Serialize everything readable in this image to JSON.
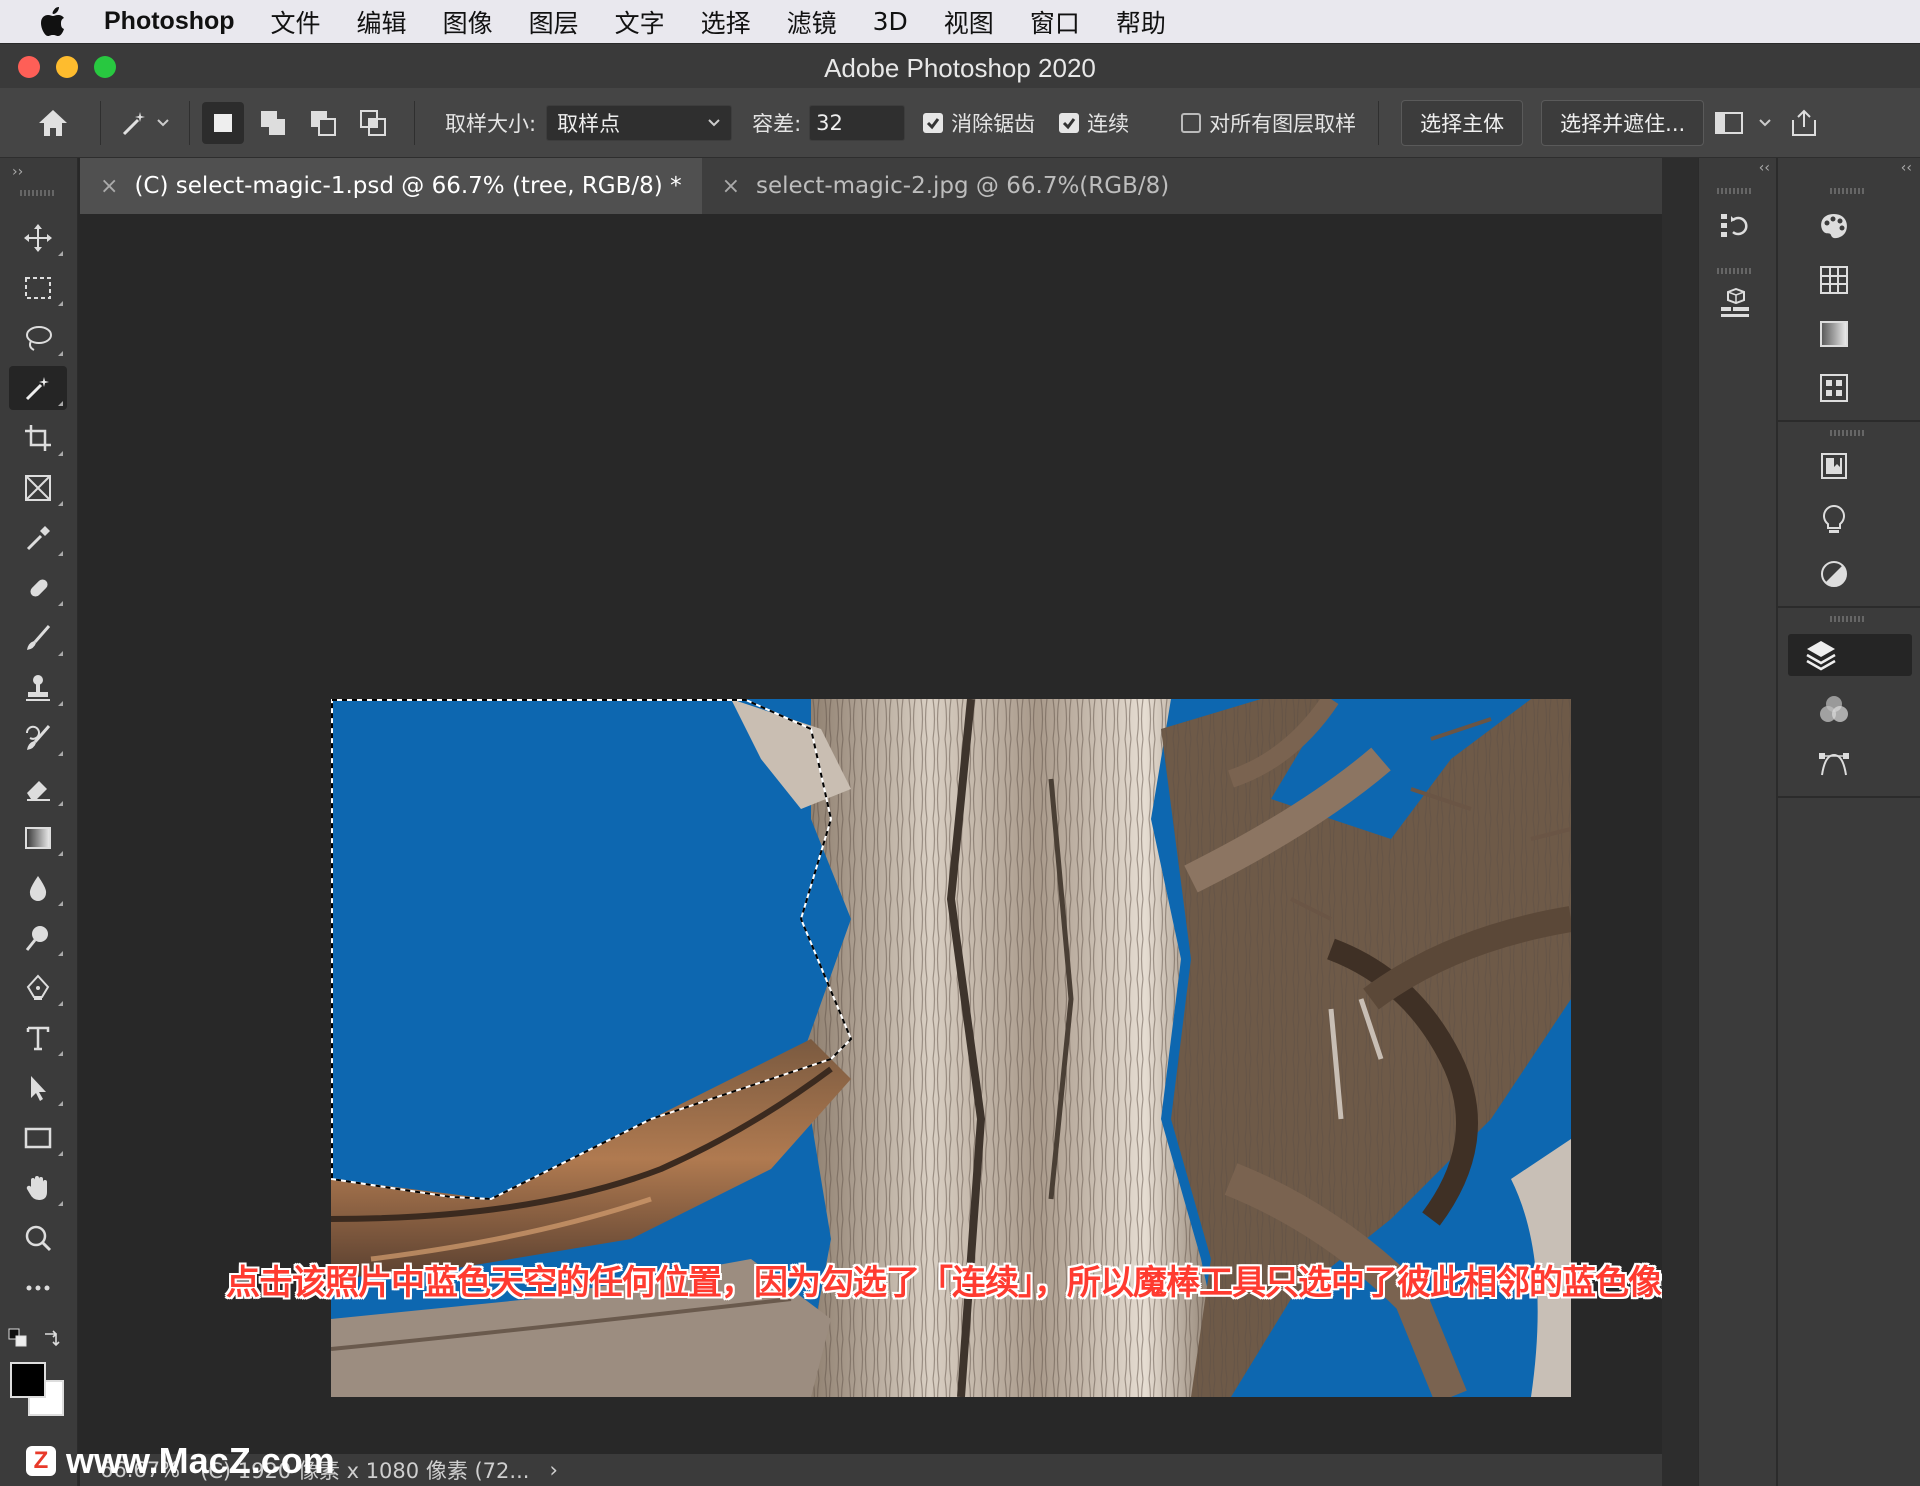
{
  "menubar": {
    "app": "Photoshop",
    "items": [
      "文件",
      "编辑",
      "图像",
      "图层",
      "文字",
      "选择",
      "滤镜",
      "3D",
      "视图",
      "窗口",
      "帮助"
    ]
  },
  "window": {
    "title": "Adobe Photoshop 2020"
  },
  "options": {
    "sample_size_label": "取样大小:",
    "sample_size_value": "取样点",
    "tolerance_label": "容差:",
    "tolerance_value": "32",
    "antialias_label": "消除锯齿",
    "contiguous_label": "连续",
    "sample_all_layers_label": "对所有图层取样",
    "select_subject_label": "选择主体",
    "select_mask_label": "选择并遮住..."
  },
  "tabs": [
    {
      "label": "(C) select-magic-1.psd @ 66.7% (tree, RGB/8) *",
      "close": "×"
    },
    {
      "label": "select-magic-2.jpg @ 66.7%(RGB/8)",
      "close": "×"
    }
  ],
  "caption": "点击该照片中蓝色天空的任何位置，因为勾选了「连续」，所以魔棒工具只选中了彼此相邻的蓝色像素",
  "statusbar": {
    "zoom": "66.67%",
    "doc_info": "(C) 1920 像素 x 1080 像素 (72...",
    "arrow": "›"
  },
  "watermark": "www.MacZ.com",
  "colors": {
    "sky": "#0d67b0",
    "caption": "#ff3b30",
    "ui_dark": "#3b3b3b"
  },
  "icons": {
    "tools": [
      "move-icon",
      "marquee-icon",
      "lasso-icon",
      "magic-wand-icon",
      "crop-icon",
      "frame-icon",
      "eyedropper-icon",
      "healing-brush-icon",
      "brush-icon",
      "clone-stamp-icon",
      "history-brush-icon",
      "eraser-icon",
      "gradient-icon",
      "blur-icon",
      "dodge-icon",
      "pen-icon",
      "type-icon",
      "path-select-icon",
      "rectangle-icon",
      "hand-icon",
      "zoom-icon",
      "more-tools-icon"
    ]
  }
}
